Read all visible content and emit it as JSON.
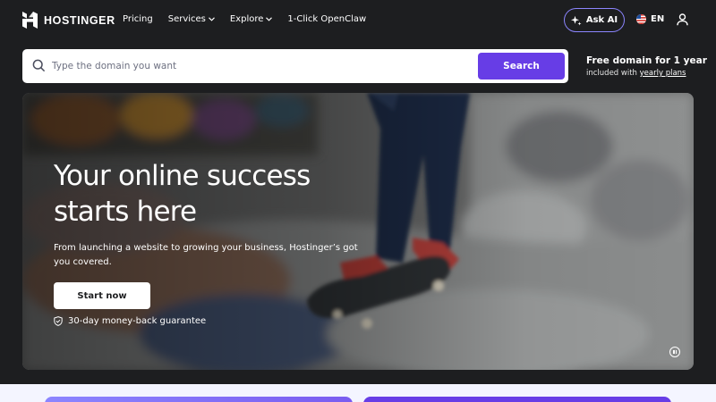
{
  "header": {
    "logo_text": "HOSTINGER",
    "nav": [
      {
        "label": "Pricing",
        "has_menu": false
      },
      {
        "label": "Services",
        "has_menu": true
      },
      {
        "label": "Explore",
        "has_menu": true
      },
      {
        "label": "1-Click OpenClaw",
        "has_menu": false
      }
    ],
    "ask_ai_label": "Ask AI",
    "language": "EN",
    "icons": {
      "ask_ai": "sparkle-icon",
      "language": "us-flag-icon",
      "account": "user-icon"
    }
  },
  "search": {
    "placeholder": "Type the domain you want",
    "value": "",
    "button_label": "Search"
  },
  "promo": {
    "title": "Free domain for 1 year",
    "subtitle_prefix": "included with",
    "subtitle_link": "yearly plans"
  },
  "hero": {
    "title": "Your online success starts here",
    "text": "From launching a website to growing your business, Hostinger’s got you covered.",
    "cta_label": "Start now",
    "guarantee": "30-day money-back guarantee"
  },
  "colors": {
    "background": "#1d1e20",
    "brand_purple": "#673de6",
    "accent_purple": "#8c85ff",
    "white": "#ffffff"
  }
}
